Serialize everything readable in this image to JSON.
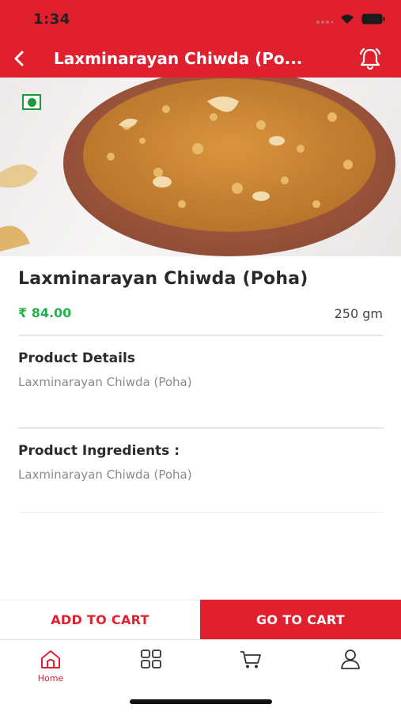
{
  "status_bar": {
    "time": "1:34"
  },
  "header": {
    "title": "Laxminarayan Chiwda (Po...",
    "back_icon": "chevron-left-icon",
    "notification_icon": "bell-ring-icon"
  },
  "product": {
    "image_description_icon": "veg-mark-icon",
    "name": "Laxminarayan Chiwda (Poha)",
    "price": "₹ 84.00",
    "weight": "250 gm"
  },
  "details": {
    "title": "Product Details",
    "text": "Laxminarayan Chiwda (Poha)"
  },
  "ingredients": {
    "title": "Product Ingredients :",
    "text": "Laxminarayan Chiwda (Poha)"
  },
  "actions": {
    "add_to_cart": "ADD TO CART",
    "go_to_cart": "GO TO CART"
  },
  "tabbar": {
    "items": [
      {
        "label": "Home",
        "icon": "home-icon",
        "active": true
      },
      {
        "label": "",
        "icon": "grid-icon",
        "active": false
      },
      {
        "label": "",
        "icon": "cart-icon",
        "active": false
      },
      {
        "label": "",
        "icon": "user-icon",
        "active": false
      }
    ]
  },
  "colors": {
    "brand": "#e0202e",
    "price": "#1fb34d",
    "veg": "#1a9a3a"
  }
}
